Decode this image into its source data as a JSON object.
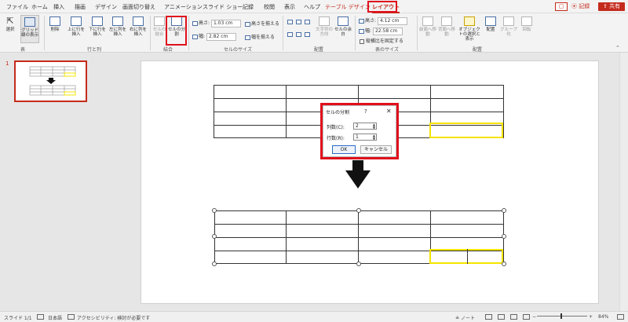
{
  "menu": {
    "tabs": [
      "ファイル",
      "ホーム",
      "挿入",
      "描画",
      "デザイン",
      "画面切り替え",
      "アニメーション",
      "スライド ショー",
      "記録",
      "校閲",
      "表示",
      "ヘルプ",
      "テーブル デザイン",
      "レイアウト"
    ],
    "comment_icon": "comment-icon",
    "record_label": "記録",
    "share_label": "共有"
  },
  "ribbon": {
    "select_label": "選択",
    "gridlines_label": "グリッド線の表示",
    "delete_label": "削除",
    "insert_above_label": "上に行を挿入",
    "insert_below_label": "下に行を挿入",
    "insert_left_label": "左に列を挿入",
    "insert_right_label": "右に列を挿入",
    "merge_cells_label": "セルの結合",
    "split_cells_label": "セルの分割",
    "height_label": "高さ:",
    "height_value": "1.03 cm",
    "width_label": "幅:",
    "width_value": "2.82 cm",
    "distribute_rows_label": "高さを揃える",
    "distribute_cols_label": "幅を揃える",
    "text_direction_label": "文字列の方向",
    "cell_margins_label": "セルの余白",
    "table_height_label": "高さ:",
    "table_height_value": "4.12 cm",
    "table_width_label": "幅:",
    "table_width_value": "22.58 cm",
    "lock_aspect_label": "縦横比を固定する",
    "bring_forward_label": "前面へ移動",
    "send_backward_label": "背面へ移動",
    "selection_pane_label": "オブジェクトの選択と表示",
    "align_label": "配置",
    "group_label": "グループ化",
    "rotate_label": "回転",
    "groups": {
      "table": "表",
      "rows_cols": "行と列",
      "merge": "結合",
      "cell_size": "セルのサイズ",
      "alignment": "配置",
      "table_size": "表のサイズ",
      "arrange": "配置"
    }
  },
  "thumbnail": {
    "number": "1"
  },
  "dialog": {
    "title": "セルの分割",
    "help": "?",
    "close": "✕",
    "columns_label": "列数(C):",
    "columns_value": "2",
    "rows_label": "行数(R):",
    "rows_value": "1",
    "ok_label": "OK",
    "cancel_label": "キャンセル"
  },
  "status": {
    "slide_info": "スライド 1/1",
    "language": "日本語",
    "accessibility": "アクセシビリティ: 検討が必要です",
    "notes_label": "ノート",
    "zoom_minus": "−",
    "zoom_plus": "+",
    "zoom_level": "84%"
  },
  "colors": {
    "accent": "#c42b1c",
    "highlight_red": "#e0101c",
    "highlight_yellow": "#f5e400"
  }
}
